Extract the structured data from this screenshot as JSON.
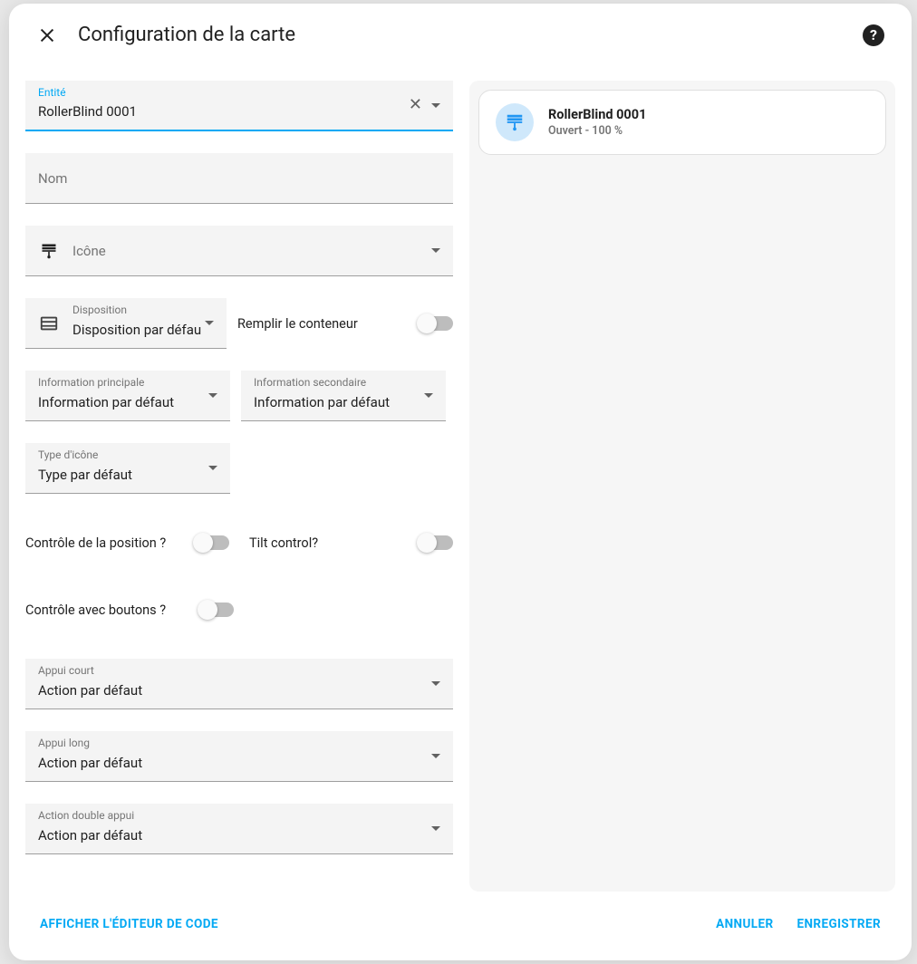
{
  "header": {
    "title": "Configuration de la carte"
  },
  "entity": {
    "label": "Entité",
    "value": "RollerBlind 0001"
  },
  "name": {
    "label": "Nom",
    "value": ""
  },
  "icon": {
    "label": "Icône",
    "value": ""
  },
  "layout": {
    "label": "Disposition",
    "value": "Disposition par défau"
  },
  "fill_container": {
    "label": "Remplir le conteneur",
    "value": false
  },
  "primary_info": {
    "label": "Information principale",
    "value": "Information par défaut"
  },
  "secondary_info": {
    "label": "Information secondaire",
    "value": "Information par défaut"
  },
  "icon_type": {
    "label": "Type d'icône",
    "value": "Type par défaut"
  },
  "position_control": {
    "label": "Contrôle de la position ?",
    "value": false
  },
  "tilt_control": {
    "label": "Tilt control?",
    "value": false
  },
  "buttons_control": {
    "label": "Contrôle avec boutons ?",
    "value": false
  },
  "tap_action": {
    "label": "Appui court",
    "value": "Action par défaut"
  },
  "hold_action": {
    "label": "Appui long",
    "value": "Action par défaut"
  },
  "double_tap_action": {
    "label": "Action double appui",
    "value": "Action par défaut"
  },
  "preview": {
    "title": "RollerBlind 0001",
    "subtitle": "Ouvert - 100 %"
  },
  "footer": {
    "code_editor": "AFFICHER L'ÉDITEUR DE CODE",
    "cancel": "ANNULER",
    "save": "ENREGISTRER"
  }
}
